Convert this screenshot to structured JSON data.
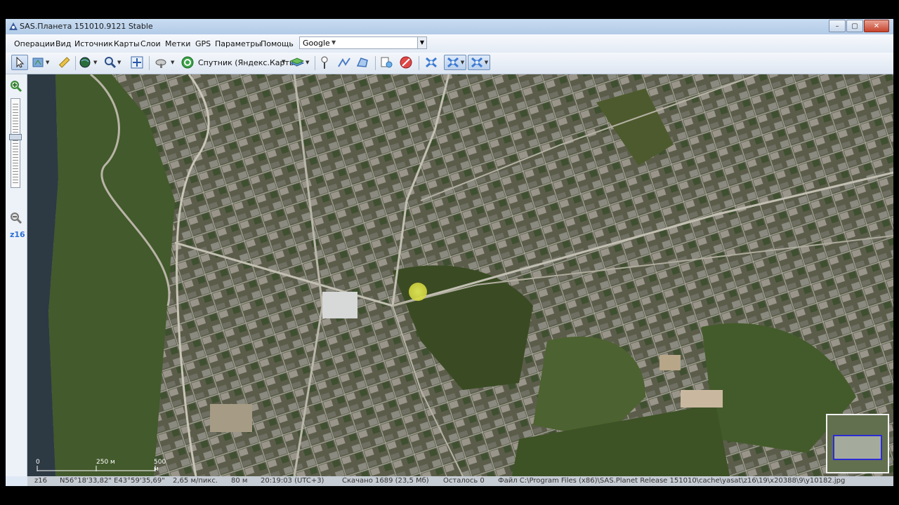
{
  "window": {
    "title": "SAS.Планета 151010.9121 Stable"
  },
  "window_controls": [
    "–",
    "▢",
    "✕"
  ],
  "menu": [
    "Операции",
    "Вид",
    "Источник",
    "Карты",
    "Слои",
    "Метки",
    "GPS",
    "Параметры",
    "Помощь"
  ],
  "search": {
    "provider": "Google",
    "value": ""
  },
  "toolbar": {
    "map_source": "Спутник (Яндекс.Карты)"
  },
  "left_panel": {
    "zoom_level": "z16"
  },
  "scale": {
    "start": "0",
    "mid": "250 м",
    "end": "500 м"
  },
  "status": {
    "zoom": "z16",
    "coordinates": "N56°18'33,82\" E43°59'35,69\"",
    "resolution": "2,65 м/пикс.",
    "altitude": "80 м",
    "time": "20:19:03 (UTC+3)",
    "downloaded": "Скачано 1689 (23,5 Мб)",
    "remaining": "Осталось 0",
    "file": "Файл C:\\Program Files (x86)\\SAS.Planet Release 151010\\cache\\yasat\\z16\\19\\x20388\\9\\y10182.jpg"
  },
  "colors": {
    "accent": "#2c6fd3",
    "window_bg": "#dfe9f5",
    "status_bg": "#c7cdd4"
  }
}
